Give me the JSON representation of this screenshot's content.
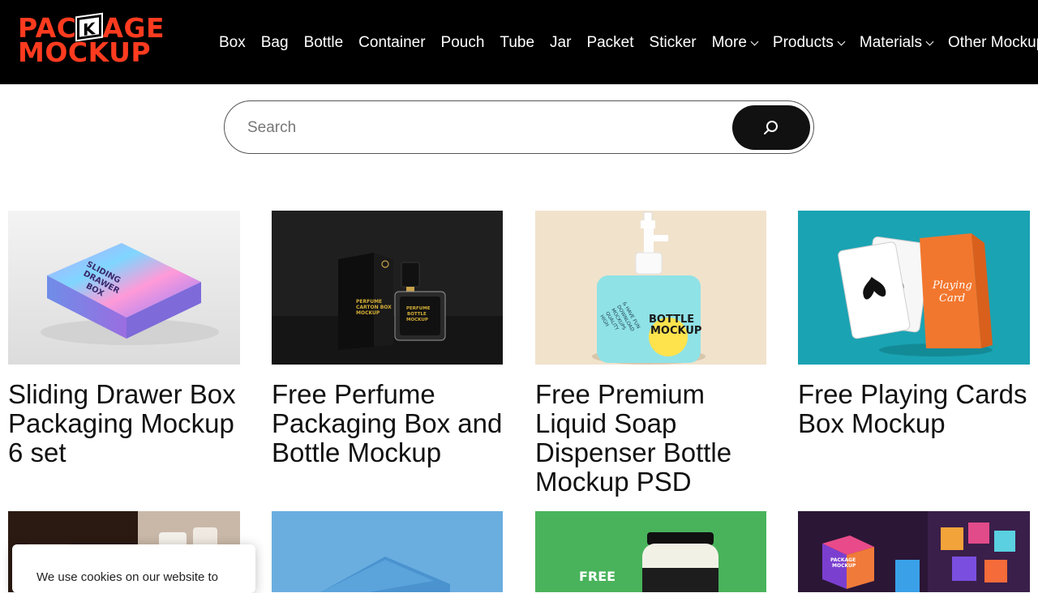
{
  "header": {
    "logo": {
      "line1_a": "PAC",
      "line1_k": "K",
      "line1_b": "AGE",
      "line2": "MOCKUP"
    },
    "nav": [
      {
        "label": "Box",
        "dropdown": false
      },
      {
        "label": "Bag",
        "dropdown": false
      },
      {
        "label": "Bottle",
        "dropdown": false
      },
      {
        "label": "Container",
        "dropdown": false
      },
      {
        "label": "Pouch",
        "dropdown": false
      },
      {
        "label": "Tube",
        "dropdown": false
      },
      {
        "label": "Jar",
        "dropdown": false
      },
      {
        "label": "Packet",
        "dropdown": false
      },
      {
        "label": "Sticker",
        "dropdown": false
      },
      {
        "label": "More",
        "dropdown": true
      },
      {
        "label": "Products",
        "dropdown": true
      },
      {
        "label": "Materials",
        "dropdown": true
      },
      {
        "label": "Other Mockup",
        "dropdown": false
      }
    ]
  },
  "search": {
    "placeholder": "Search"
  },
  "cards": [
    {
      "title": "Sliding Drawer Box Packaging Mockup 6 set",
      "image": "sliding-drawer-box",
      "thumb_text": [
        "SLIDING",
        "DRAWER",
        "BOX"
      ]
    },
    {
      "title": "Free Perfume Packaging Box and Bottle Mockup",
      "image": "perfume-box-bottle",
      "thumb_text": [
        "PERFUME",
        "CARTON BOX",
        "MOCKUP",
        "PERFUME",
        "BOTTLE",
        "MOCKUP"
      ]
    },
    {
      "title": "Free Premium Liquid Soap Dispenser Bottle Mockup PSD",
      "image": "soap-dispenser-bottle",
      "thumb_text": [
        "BOTTLE",
        "MOCKUP",
        "HIGH",
        "QUALITY",
        "MOCKUPS",
        "DOWNLOAD",
        "& HAVE FUN"
      ]
    },
    {
      "title": "Free Playing Cards Box Mockup",
      "image": "playing-cards-box",
      "thumb_text": [
        "Playing",
        "Card"
      ]
    }
  ],
  "row2": [
    {
      "image": "candle-jars"
    },
    {
      "image": "blue-box"
    },
    {
      "image": "green-jar",
      "thumb_text": "FREE"
    },
    {
      "image": "colorful-cubes",
      "thumb_text": [
        "PACKAGE",
        "MOCKUP"
      ]
    }
  ],
  "cookie": {
    "text": "We use cookies on our website to"
  },
  "colors": {
    "brand": "#ff3b1f",
    "header_bg": "#000000",
    "search_button": "#111111"
  }
}
